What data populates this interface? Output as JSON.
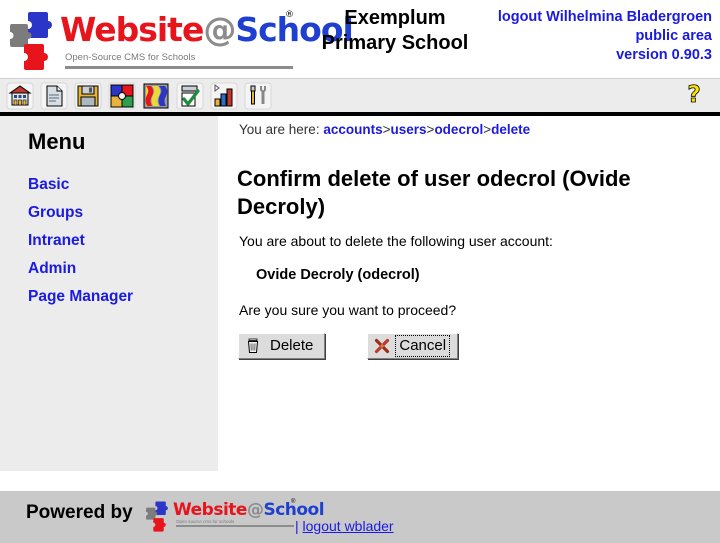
{
  "header": {
    "logo": {
      "name_part1": "Website",
      "name_at": "@",
      "name_part2": "School",
      "registered_mark": "®",
      "tagline": "Open-Source CMS for Schools"
    },
    "school_name_line1": "Exemplum",
    "school_name_line2": "Primary School",
    "right_lines": [
      "logout Wilhelmina Bladergroen",
      "public area",
      "version 0.90.3"
    ]
  },
  "toolbar": {
    "icons": [
      {
        "name": "school-home-icon",
        "title": "Home"
      },
      {
        "name": "page-document-icon",
        "title": "Pages"
      },
      {
        "name": "floppy-save-icon",
        "title": "Save"
      },
      {
        "name": "modules-puzzle-icon",
        "title": "Modules"
      },
      {
        "name": "themes-palette-icon",
        "title": "Themes"
      },
      {
        "name": "checklist-approve-icon",
        "title": "Tasks"
      },
      {
        "name": "statistics-chart-icon",
        "title": "Statistics"
      },
      {
        "name": "tools-wrench-icon",
        "title": "Tools"
      }
    ],
    "help_icon": {
      "name": "help-question-icon",
      "glyph": "?",
      "color": "#ffe600"
    }
  },
  "sidebar": {
    "title": "Menu",
    "items": [
      {
        "label": "Basic"
      },
      {
        "label": "Groups"
      },
      {
        "label": "Intranet"
      },
      {
        "label": "Admin"
      },
      {
        "label": "Page Manager"
      }
    ]
  },
  "content": {
    "breadcrumb": {
      "prefix": "You are here:",
      "items": [
        "accounts",
        "users",
        "odecrol",
        "delete"
      ],
      "separator": ">"
    },
    "page_title": "Confirm delete of user odecrol (Ovide Decroly)",
    "intro_text": "You are about to delete the following user account:",
    "account_name": "Ovide Decroly (odecrol)",
    "confirm_text": "Are you sure you want to proceed?",
    "buttons": {
      "delete": {
        "label": "Delete",
        "icon": "trash-can-icon"
      },
      "cancel": {
        "label": "Cancel",
        "icon": "red-cross-icon",
        "focused": true
      }
    }
  },
  "footer": {
    "powered_by": "Powered by",
    "logo": {
      "name_part1": "Website",
      "name_at": "@",
      "name_part2": "School",
      "registered_mark": "®",
      "tagline": "Open source cms for schools"
    },
    "separator": "|",
    "logout_label": "logout wblader"
  },
  "colors": {
    "link_blue": "#1a1ae0",
    "logo_red": "#e8141c",
    "logo_blue": "#1f3fd0",
    "logo_gray": "#8c8c8c",
    "sidebar_bg": "#ececec",
    "footer_bg": "#c9c9c9",
    "help_yellow": "#ffe600"
  }
}
